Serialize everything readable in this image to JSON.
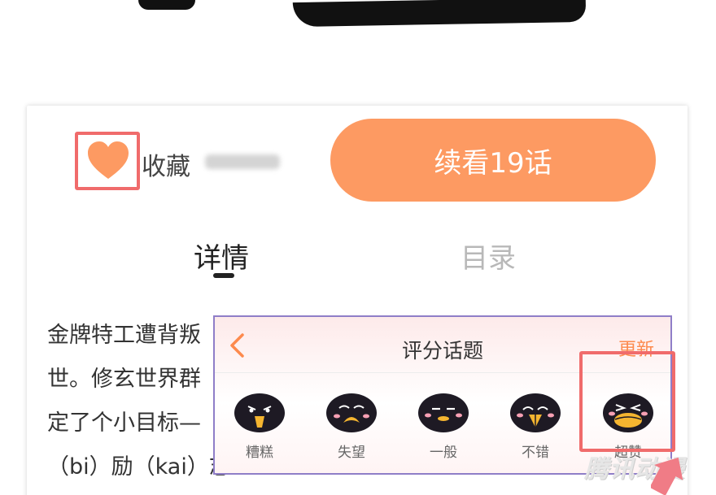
{
  "favorite": {
    "label": "收藏",
    "icon": "heart-icon"
  },
  "continue_button": {
    "label": "续看19话"
  },
  "tabs": [
    {
      "label": "详情",
      "active": true
    },
    {
      "label": "目录",
      "active": false
    }
  ],
  "description": {
    "lines": [
      "金牌特工遭背叛",
      "世。修玄世界群",
      "定了个小目标—",
      "（bi）励（kai）志"
    ]
  },
  "rating_popup": {
    "title": "评分话题",
    "refresh": "更新",
    "back_icon": "chevron-left-icon",
    "options": [
      {
        "label": "糟糕",
        "icon": "penguin-awful-icon"
      },
      {
        "label": "失望",
        "icon": "penguin-disappointed-icon"
      },
      {
        "label": "一般",
        "icon": "penguin-average-icon"
      },
      {
        "label": "不错",
        "icon": "penguin-good-icon"
      },
      {
        "label": "超赞",
        "icon": "penguin-great-icon"
      }
    ]
  },
  "watermark": "腾讯动漫",
  "colors": {
    "accent": "#fd9a62",
    "highlight": "#f06b6b",
    "popup_border": "#8f7ec8"
  }
}
